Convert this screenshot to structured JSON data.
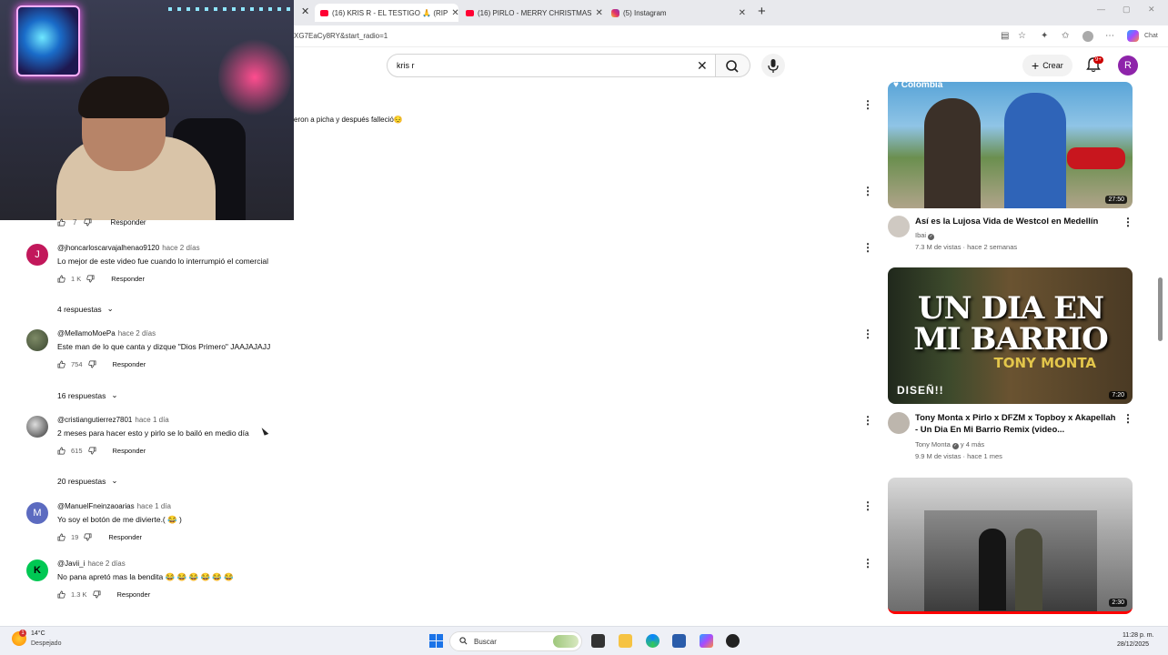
{
  "browser": {
    "tabs": [
      {
        "label": "(16) KRIS R - EL TESTIGO 🙏 (RIP",
        "icon": "youtube-icon",
        "active": true
      },
      {
        "label": "(16) PIRLO - MERRY CHRISTMAS",
        "icon": "youtube-icon",
        "active": false
      },
      {
        "label": "(5) Instagram",
        "icon": "instagram-icon",
        "active": false
      }
    ],
    "url": "XG7EaCy8RY&start_radio=1",
    "copilot_label": "Chat"
  },
  "header": {
    "search_value": "kris r",
    "create_label": "Crear",
    "notification_count": "9+",
    "avatar_letter": "R"
  },
  "snippet_text": "eron a picha y después falleció😔",
  "stray_row": {
    "likes": "7",
    "reply_label": "Responder"
  },
  "comments": [
    {
      "author": "@jhoncarloscarvajalhenao9120",
      "time": "hace 2 días",
      "text": "Lo mejor de este video fue cuando lo  interrumpió el comercial",
      "likes": "1 K",
      "reply_label": "Responder",
      "avatar_letter": "J",
      "avatar_color": "#c2185b",
      "replies": "4 respuestas"
    },
    {
      "author": "@MellamoMoePa",
      "time": "hace 2 días",
      "text": "Este man de lo que canta y dizque \"Dios Primero\" JAAJAJAJJ",
      "likes": "754",
      "reply_label": "Responder",
      "avatar_letter": "",
      "avatar_color": "#4a5a3a",
      "replies": "16 respuestas"
    },
    {
      "author": "@cristiangutierrez7801",
      "time": "hace 1 día",
      "text": "2 meses para hacer esto y pirlo se lo bailó en medio día",
      "likes": "615",
      "reply_label": "Responder",
      "avatar_letter": "",
      "avatar_color": "#555555",
      "replies": "20 respuestas"
    },
    {
      "author": "@ManuelFneinzaoarias",
      "time": "hace 1 día",
      "text": "Yo soy el botón de me divierte.( 😂 )",
      "likes": "19",
      "reply_label": "Responder",
      "avatar_letter": "M",
      "avatar_color": "#5c6bc0",
      "replies": ""
    },
    {
      "author": "@Javii_i",
      "time": "hace 2 días",
      "text": "No pana apretó mas la bendita 😂 😂 😂 😂 😂 😂",
      "likes": "1.3 K",
      "reply_label": "Responder",
      "avatar_letter": "K",
      "avatar_color": "#00c853",
      "replies": ""
    }
  ],
  "related_videos": [
    {
      "title": "Así es la Lujosa Vida de Westcol en Medellín",
      "channel": "Ibai",
      "verified": true,
      "stats": "7.3 M de vistas · hace 2 semanas",
      "duration": "27:50",
      "badge": "♥ Colombia"
    },
    {
      "title": "Tony Monta x Pirlo x DFZM x Topboy x Akapellah - Un Dia En Mi Barrio Remix (video...",
      "channel": "Tony Monta",
      "verified": true,
      "extra": "y 4 más",
      "stats": "9.9 M de vistas · hace 1 mes",
      "duration": "7:20",
      "thumb_title": "UN DIA EN MI BARRIO",
      "thumb_sub": "TONY MONTA",
      "thumb_corner": "DISEÑ!!"
    },
    {
      "duration": "2:30"
    }
  ],
  "taskbar": {
    "weather_temp": "14°C",
    "weather_desc": "Despejado",
    "weather_badge": "1",
    "search_label": "Buscar",
    "time": "11:28 p. m.",
    "date": "28/12/2025"
  },
  "colors": {
    "youtube_red": "#ff0000",
    "accent": "#1a73e8"
  }
}
